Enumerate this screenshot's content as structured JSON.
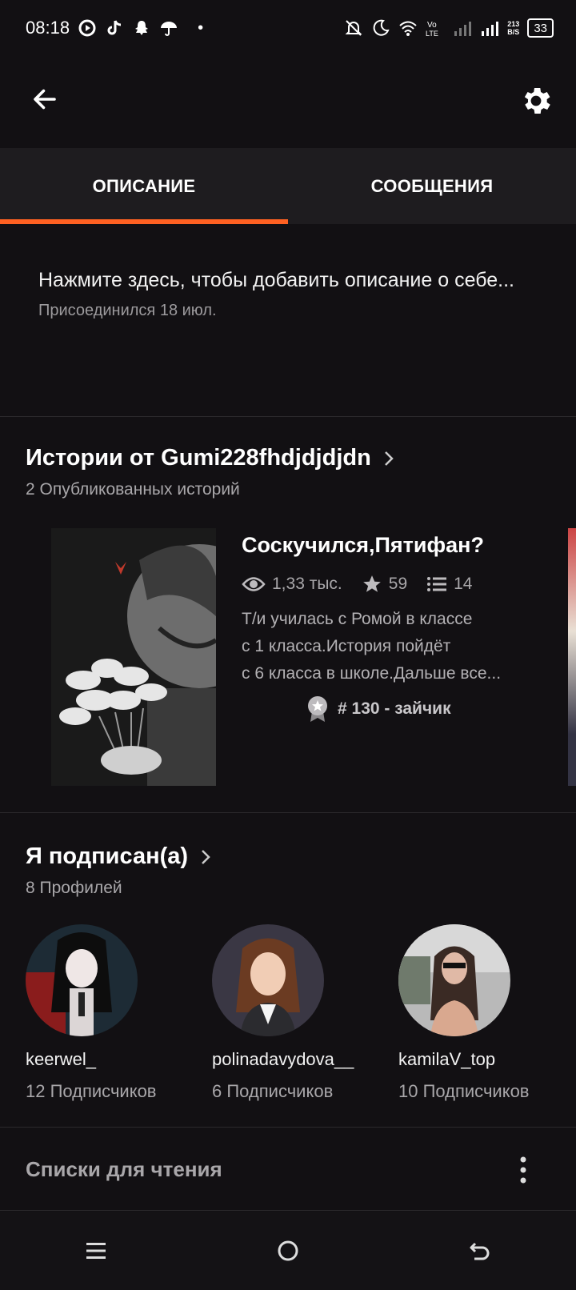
{
  "status_bar": {
    "time": "08:18",
    "network_speed": "213\nB/S",
    "battery": "33",
    "dot": "•"
  },
  "header": {
    "back_icon": "arrow-left-icon",
    "settings_icon": "gear-icon"
  },
  "tabs": [
    {
      "label": "ОПИСАНИЕ",
      "active": true
    },
    {
      "label": "СООБЩЕНИЯ",
      "active": false
    }
  ],
  "about": {
    "prompt": "Нажмите здесь, чтобы добавить описание о себе...",
    "joined": "Присоединился 18 июл."
  },
  "stories_section": {
    "title": "Истории от Gumi228fhdjdjdjdn",
    "subtitle": "2 Опубликованных историй",
    "story": {
      "title": "Соскучился,Пятифан?",
      "views": "1,33 тыс.",
      "votes": "59",
      "parts": "14",
      "description_lines": [
        "Т/и училась с Ромой в классе",
        "с 1 класса.История пойдёт",
        "с 6 класса в школе.Дальше все..."
      ],
      "rank": "# 130 - зайчик"
    }
  },
  "following_section": {
    "title": "Я подписан(а)",
    "subtitle": "8 Профилей",
    "profiles": [
      {
        "name": "keerwel_",
        "followers": "12 Подписчиков"
      },
      {
        "name": "polinadavydova__",
        "followers": "6 Подписчиков"
      },
      {
        "name": "kamilaV_top",
        "followers": "10 Подписчиков"
      }
    ]
  },
  "reading_lists": {
    "title": "Списки для чтения"
  },
  "colors": {
    "accent": "#ff6122",
    "background": "#121013",
    "tab_bg": "#1e1c1f"
  }
}
